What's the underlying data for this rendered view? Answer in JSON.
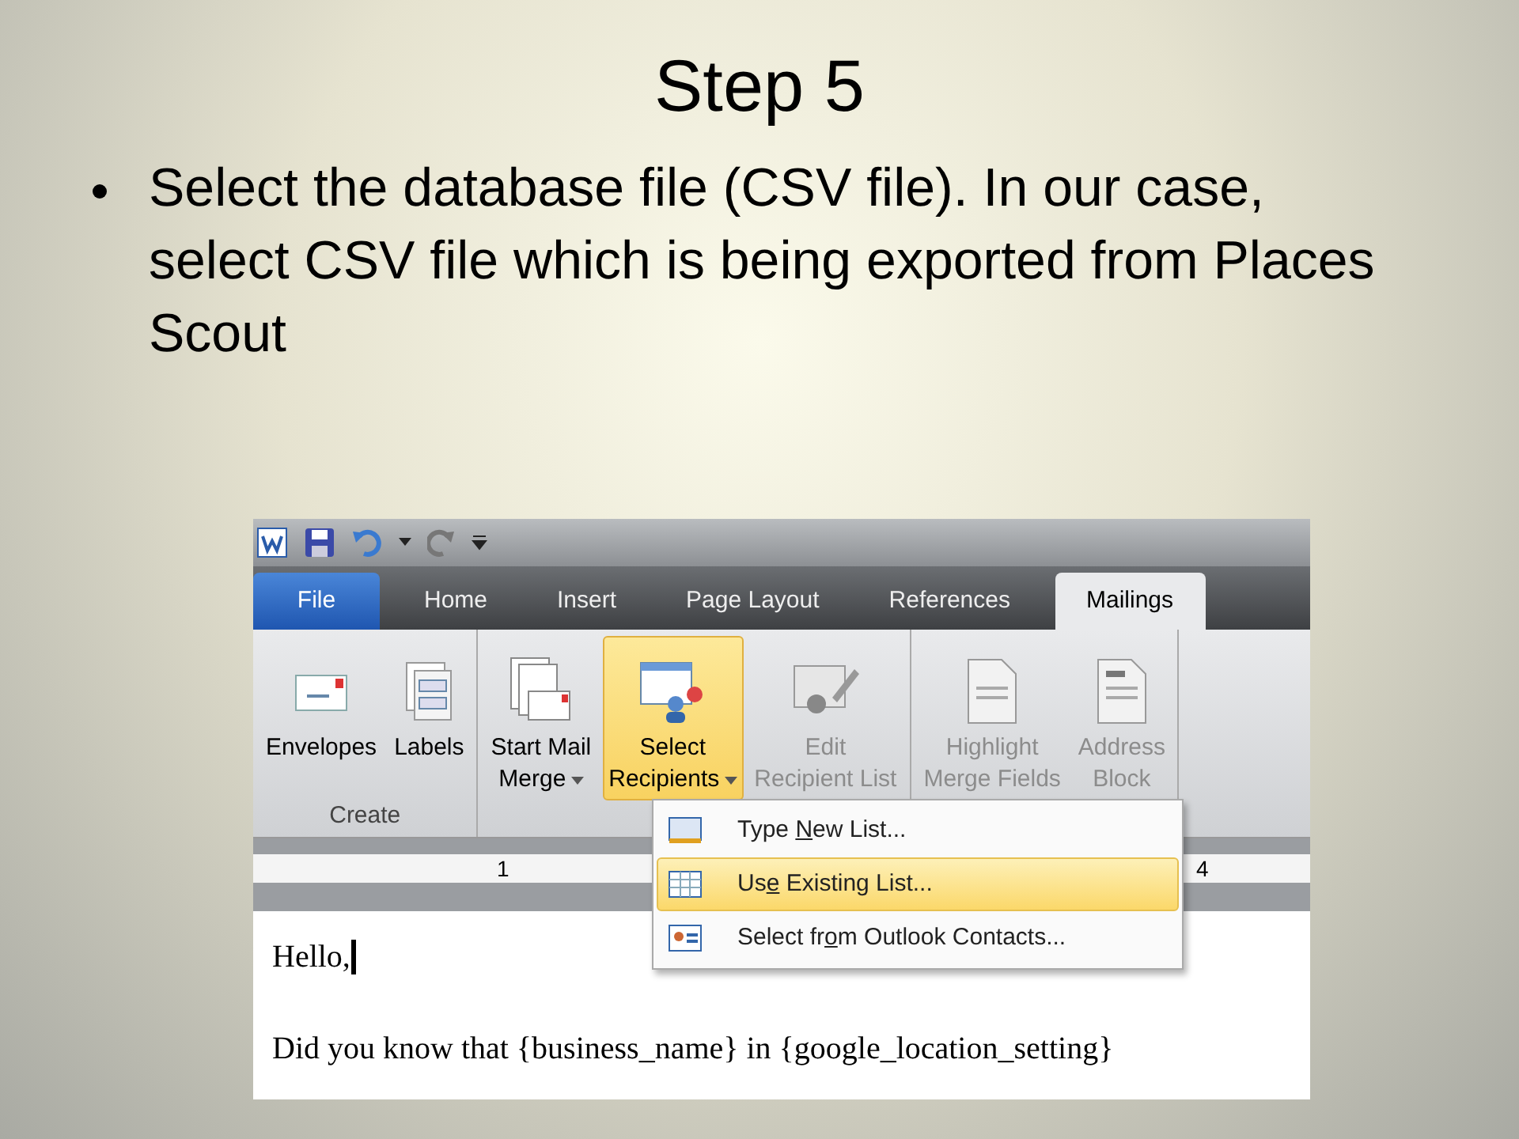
{
  "slide": {
    "title": "Step 5",
    "bullets": [
      "Select the database file (CSV file). In our case, select CSV file which is being exported from Places Scout"
    ]
  },
  "screenshot": {
    "tabs": [
      {
        "label": "File",
        "kind": "file",
        "selected": false
      },
      {
        "label": "Home",
        "kind": "tab",
        "selected": false
      },
      {
        "label": "Insert",
        "kind": "tab",
        "selected": false
      },
      {
        "label": "Page Layout",
        "kind": "tab",
        "selected": false
      },
      {
        "label": "References",
        "kind": "tab",
        "selected": false
      },
      {
        "label": "Mailings",
        "kind": "tab",
        "selected": true
      }
    ],
    "ribbon_groups": [
      {
        "label": "Create",
        "buttons": [
          {
            "lines": [
              "Envelopes"
            ],
            "dropdown": false,
            "disabled": false,
            "highlighted": false
          },
          {
            "lines": [
              "Labels"
            ],
            "dropdown": false,
            "disabled": false,
            "highlighted": false
          }
        ]
      },
      {
        "buttons": [
          {
            "lines": [
              "Start Mail",
              "Merge"
            ],
            "dropdown": true,
            "disabled": false,
            "highlighted": false
          },
          {
            "lines": [
              "Select",
              "Recipients"
            ],
            "dropdown": true,
            "disabled": false,
            "highlighted": true
          },
          {
            "lines": [
              "Edit",
              "Recipient List"
            ],
            "dropdown": false,
            "disabled": true,
            "highlighted": false
          }
        ]
      },
      {
        "buttons": [
          {
            "lines": [
              "Highlight",
              "Merge Fields"
            ],
            "dropdown": false,
            "disabled": true,
            "highlighted": false
          },
          {
            "lines": [
              "Address",
              "Block"
            ],
            "dropdown": false,
            "disabled": true,
            "highlighted": false
          }
        ]
      }
    ],
    "ruler_marks": [
      "1",
      "4"
    ],
    "menu": [
      {
        "before": "Type ",
        "key": "N",
        "after": "ew List...",
        "selected": false
      },
      {
        "before": "Us",
        "key": "e",
        "after": " Existing List...",
        "selected": true
      },
      {
        "before": "Select fr",
        "key": "o",
        "after": "m Outlook Contacts...",
        "selected": false
      }
    ],
    "document_lines": [
      "Hello,",
      "Did you know that {business_name} in {google_location_setting}"
    ]
  }
}
